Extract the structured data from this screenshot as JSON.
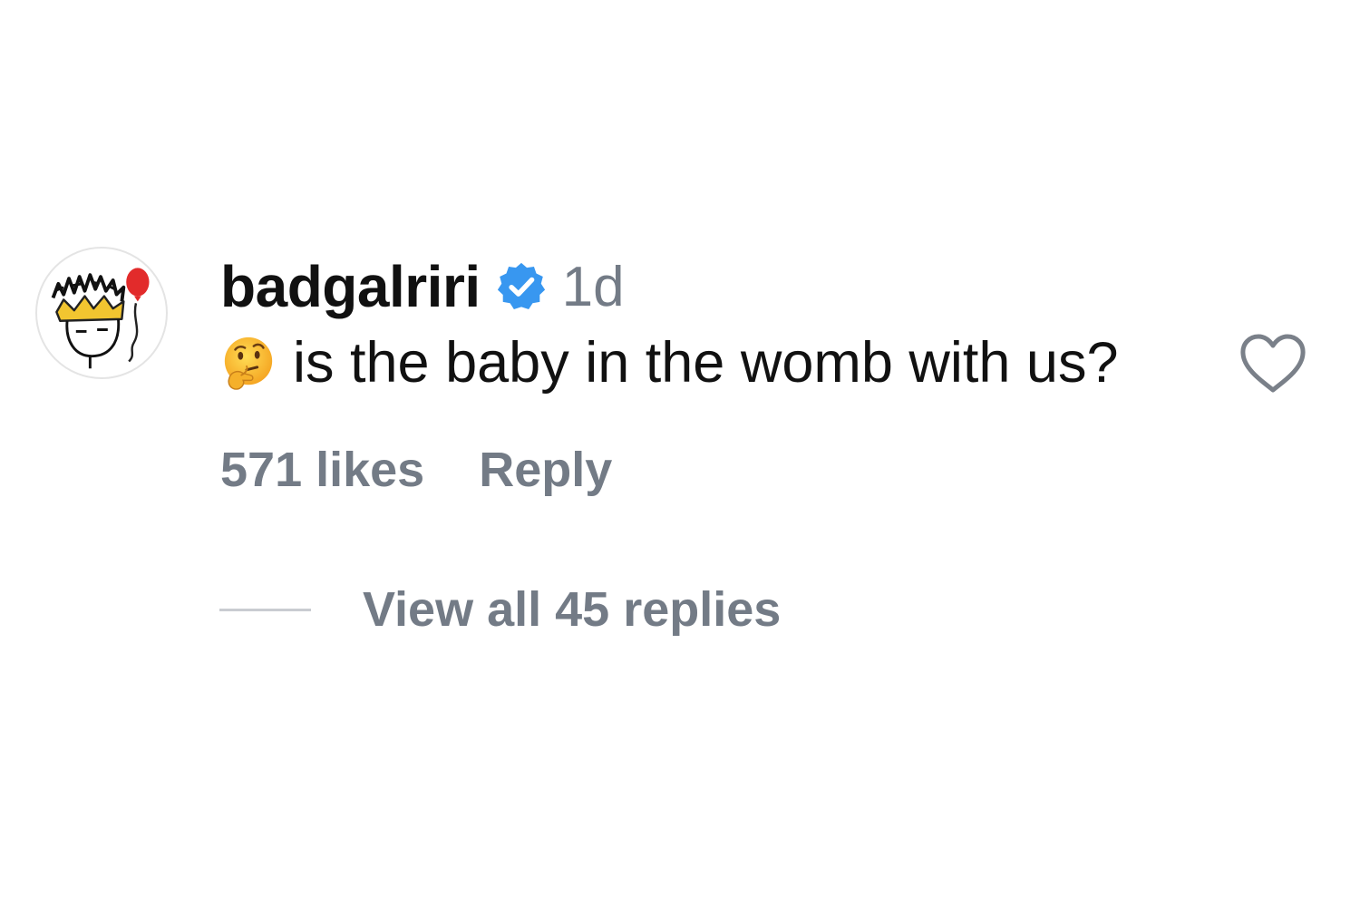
{
  "comment": {
    "username": "badgalriri",
    "verified_icon": "verified-badge-icon",
    "timestamp": "1d",
    "emoji_icon": "thinking-face-icon",
    "text": "is the baby in the womb with us?",
    "like_icon": "heart-outline-icon",
    "likes": "571 likes",
    "reply_label": "Reply",
    "view_replies_label": "View all 45 replies"
  },
  "colors": {
    "verified_blue": "#3897f0",
    "text_primary": "#111111",
    "text_secondary": "#737b86",
    "divider": "#c9ccd1"
  }
}
